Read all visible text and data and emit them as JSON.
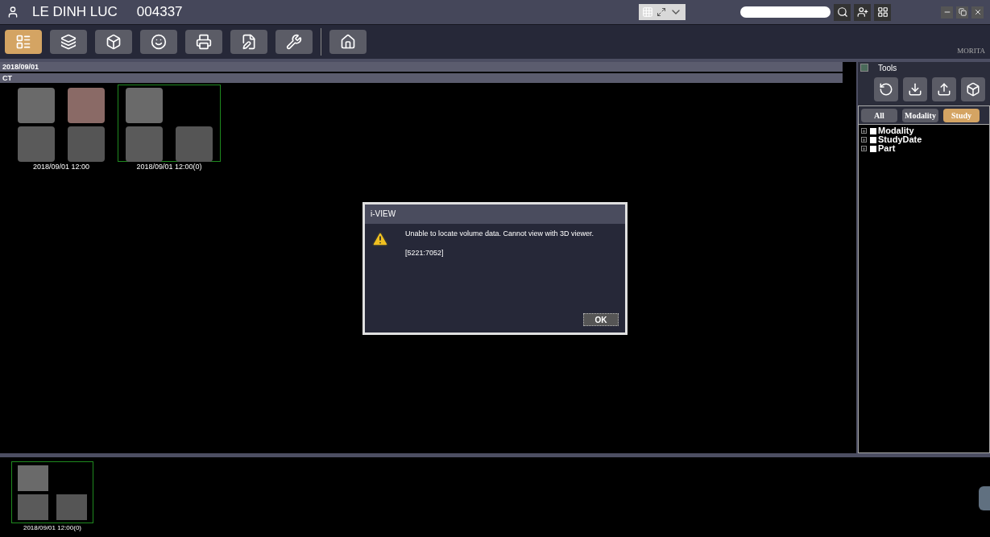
{
  "patient": {
    "name": "LE DINH LUC",
    "id": "004337"
  },
  "toolbar": [
    {
      "kind": "list",
      "selected": true
    },
    {
      "kind": "layers",
      "selected": false
    },
    {
      "kind": "volume",
      "selected": false
    },
    {
      "kind": "panorama",
      "selected": false
    },
    {
      "kind": "print",
      "selected": false
    },
    {
      "kind": "edit",
      "selected": false
    },
    {
      "kind": "tools",
      "selected": false
    },
    {
      "kind": "home",
      "selected": false
    }
  ],
  "logo": "MORITA",
  "study": {
    "date": "2018/09/01",
    "modality": "CT"
  },
  "thumbnails": [
    {
      "caption": "2018/09/01 12:00",
      "selected": false,
      "kind": "four"
    },
    {
      "caption": "2018/09/01 12:00(0)",
      "selected": true,
      "kind": "three"
    }
  ],
  "tools_panel": {
    "title": "Tools",
    "buttons": [
      {
        "kind": "rotate"
      },
      {
        "kind": "export"
      },
      {
        "kind": "import"
      },
      {
        "kind": "volume"
      }
    ],
    "filters": [
      {
        "label": "All",
        "selected": false
      },
      {
        "label": "Modality",
        "selected": false
      },
      {
        "label": "Study",
        "selected": true
      }
    ],
    "tree": [
      {
        "label": "Modality",
        "expanded": false,
        "checked": false
      },
      {
        "label": "StudyDate",
        "expanded": false,
        "checked": false
      },
      {
        "label": "Part",
        "expanded": false,
        "checked": false
      }
    ]
  },
  "bottom_thumbnails": [
    {
      "caption": "2018/09/01 12:00(0)",
      "selected": true,
      "kind": "three"
    }
  ],
  "dialog": {
    "title": "i-VIEW",
    "message": "Unable to locate volume data. Cannot view with 3D viewer.",
    "code": "[5221:7052]",
    "button": "OK"
  }
}
